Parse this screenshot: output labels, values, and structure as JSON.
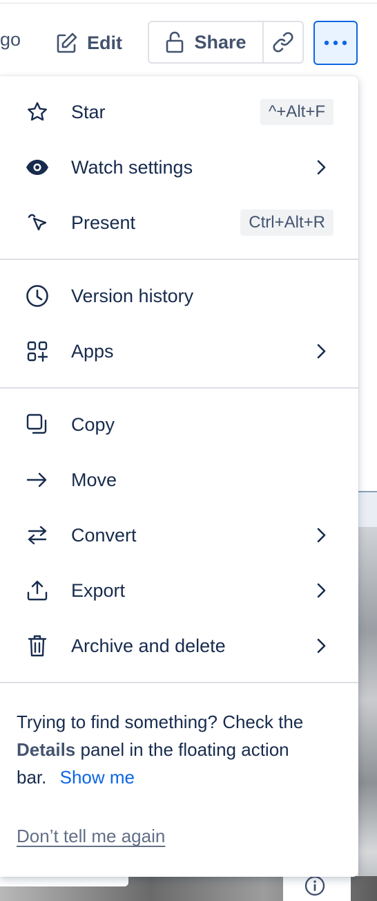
{
  "toolbar": {
    "partial_label": "go",
    "edit_label": "Edit",
    "share_label": "Share"
  },
  "menu": {
    "items": [
      {
        "label": "Star",
        "shortcut": "^+Alt+F"
      },
      {
        "label": "Watch settings"
      },
      {
        "label": "Present",
        "shortcut": "Ctrl+Alt+R"
      },
      {
        "label": "Version history"
      },
      {
        "label": "Apps"
      },
      {
        "label": "Copy"
      },
      {
        "label": "Move"
      },
      {
        "label": "Convert"
      },
      {
        "label": "Export"
      },
      {
        "label": "Archive and delete"
      }
    ],
    "tip": {
      "text_before": "Trying to find something? Check the",
      "bold": "Details",
      "text_after": "panel in the floating action bar.",
      "link": "Show me"
    },
    "dismiss": "Don’t tell me again"
  },
  "colors": {
    "accent": "#0c66e4",
    "text": "#172b4d",
    "subtle": "#42526e"
  }
}
